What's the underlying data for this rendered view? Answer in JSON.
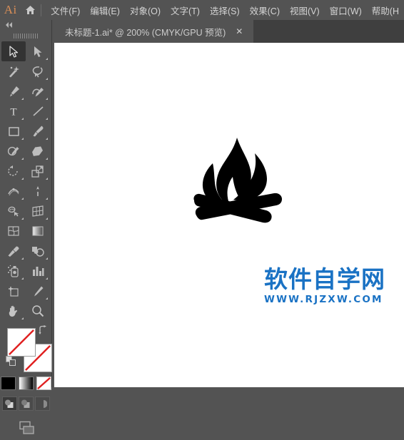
{
  "app": {
    "name": "Adobe Illustrator",
    "logo_text": "Ai",
    "logo_color": "#d98e57",
    "home_icon": "home-icon"
  },
  "menubar": {
    "items": [
      {
        "label": "文件(F)",
        "name": "menu-file"
      },
      {
        "label": "编辑(E)",
        "name": "menu-edit"
      },
      {
        "label": "对象(O)",
        "name": "menu-object"
      },
      {
        "label": "文字(T)",
        "name": "menu-type"
      },
      {
        "label": "选择(S)",
        "name": "menu-select"
      },
      {
        "label": "效果(C)",
        "name": "menu-effect"
      },
      {
        "label": "视图(V)",
        "name": "menu-view"
      },
      {
        "label": "窗口(W)",
        "name": "menu-window"
      },
      {
        "label": "帮助(H",
        "name": "menu-help"
      }
    ]
  },
  "tabbar": {
    "tab": {
      "title": "未标题-1.ai* @ 200% (CMYK/GPU 预览)",
      "close_label": "✕",
      "document_name": "未标题-1.ai",
      "modified": true,
      "zoom": "200%",
      "color_mode": "CMYK",
      "renderer": "GPU",
      "view_mode": "预览"
    }
  },
  "toolbar": {
    "collapse_label": "◀◀",
    "grip": "panel-grip",
    "tools": [
      {
        "name": "selection-tool",
        "label": "选择工具",
        "active": true,
        "corner": false
      },
      {
        "name": "direct-selection-tool",
        "label": "直接选择工具",
        "active": false,
        "corner": true
      },
      {
        "name": "magic-wand-tool",
        "label": "魔棒工具",
        "active": false,
        "corner": false
      },
      {
        "name": "lasso-tool",
        "label": "套索工具",
        "active": false,
        "corner": true
      },
      {
        "name": "pen-tool",
        "label": "钢笔工具",
        "active": false,
        "corner": true
      },
      {
        "name": "curvature-tool",
        "label": "曲率工具",
        "active": false,
        "corner": true
      },
      {
        "name": "type-tool",
        "label": "文字工具",
        "active": false,
        "corner": true
      },
      {
        "name": "line-segment-tool",
        "label": "直线段工具",
        "active": false,
        "corner": true
      },
      {
        "name": "rectangle-tool",
        "label": "矩形工具",
        "active": false,
        "corner": true
      },
      {
        "name": "paintbrush-tool",
        "label": "画笔工具",
        "active": false,
        "corner": true
      },
      {
        "name": "shaper-tool",
        "label": "Shaper 工具",
        "active": false,
        "corner": true
      },
      {
        "name": "eraser-tool",
        "label": "橡皮擦工具",
        "active": false,
        "corner": true
      },
      {
        "name": "rotate-tool",
        "label": "旋转工具",
        "active": false,
        "corner": true
      },
      {
        "name": "scale-tool",
        "label": "比例缩放工具",
        "active": false,
        "corner": true
      },
      {
        "name": "width-tool",
        "label": "宽度工具",
        "active": false,
        "corner": true
      },
      {
        "name": "free-transform-tool",
        "label": "自由变换工具",
        "active": false,
        "corner": true
      },
      {
        "name": "shape-builder-tool",
        "label": "形状生成器工具",
        "active": false,
        "corner": true
      },
      {
        "name": "perspective-grid-tool",
        "label": "透视网格工具",
        "active": false,
        "corner": true
      },
      {
        "name": "mesh-tool",
        "label": "网格工具",
        "active": false,
        "corner": false
      },
      {
        "name": "gradient-tool",
        "label": "渐变工具",
        "active": false,
        "corner": false
      },
      {
        "name": "eyedropper-tool",
        "label": "吸管工具",
        "active": false,
        "corner": true
      },
      {
        "name": "blend-tool",
        "label": "混合工具",
        "active": false,
        "corner": true
      },
      {
        "name": "symbol-sprayer-tool",
        "label": "符号喷枪工具",
        "active": false,
        "corner": true
      },
      {
        "name": "column-graph-tool",
        "label": "柱形图工具",
        "active": false,
        "corner": true
      },
      {
        "name": "artboard-tool",
        "label": "画板工具",
        "active": false,
        "corner": false
      },
      {
        "name": "slice-tool",
        "label": "切片工具",
        "active": false,
        "corner": true
      },
      {
        "name": "hand-tool",
        "label": "抓手工具",
        "active": false,
        "corner": true
      },
      {
        "name": "zoom-tool",
        "label": "缩放工具",
        "active": false,
        "corner": false
      }
    ],
    "swatches": {
      "fill": {
        "name": "fill-swatch",
        "value": "无",
        "is_none": true
      },
      "stroke": {
        "name": "stroke-swatch",
        "value": "无",
        "is_none": true
      },
      "swap_icon": "swap-arrow-icon",
      "default_icon": "default-fill-stroke-icon"
    },
    "color_modes": [
      {
        "name": "color-mode-button",
        "label": "颜色",
        "selected": false
      },
      {
        "name": "gradient-mode-button",
        "label": "渐变",
        "selected": false
      },
      {
        "name": "none-mode-button",
        "label": "无",
        "selected": true
      }
    ],
    "draw_modes": [
      {
        "name": "draw-normal-button",
        "label": "正常绘图",
        "active": true
      },
      {
        "name": "draw-behind-button",
        "label": "背面绘图",
        "active": false
      },
      {
        "name": "draw-inside-button",
        "label": "内部绘图",
        "active": false
      }
    ],
    "screen_mode": {
      "name": "screen-mode-button",
      "label": "更改屏幕模式"
    }
  },
  "canvas": {
    "background": "#ffffff",
    "artwork": {
      "name": "campfire-logo",
      "description": "黑色篝火图形",
      "color": "#000000"
    },
    "watermark": {
      "cn_text": "软件自学网",
      "url_text": "WWW.RJZXW.COM",
      "color": "#1a72c4"
    }
  }
}
